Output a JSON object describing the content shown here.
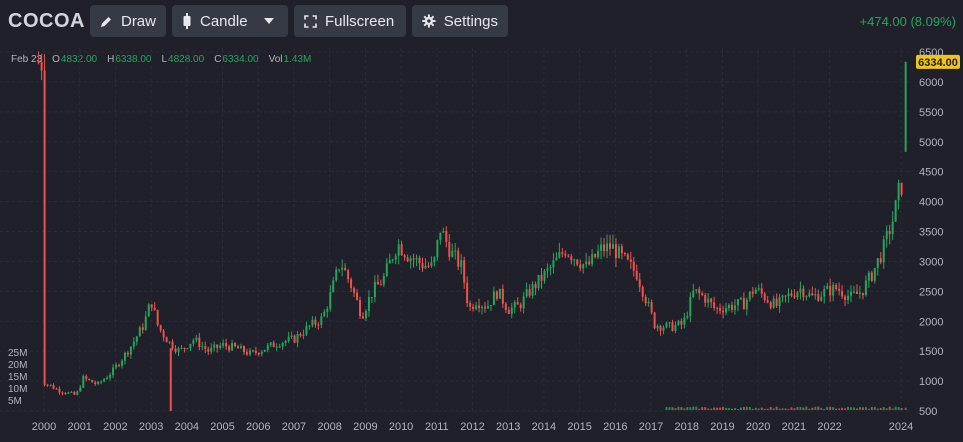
{
  "toolbar": {
    "symbol": "COCOA",
    "draw_label": "Draw",
    "candle_label": "Candle",
    "fullscreen_label": "Fullscreen",
    "settings_label": "Settings",
    "change": "+474.00 (8.09%)"
  },
  "legend": {
    "date": "Feb 23",
    "o_label": "O",
    "o_value": "4832.00",
    "h_label": "H",
    "h_value": "6338.00",
    "l_label": "L",
    "l_value": "4828.00",
    "c_label": "C",
    "c_value": "6334.00",
    "vol_label": "Vol",
    "vol_value": "1.43M"
  },
  "colors": {
    "up": "#26a65b",
    "down": "#ef5350",
    "background": "#1f2029",
    "grid": "#2b2d37",
    "last_price_badge": "#f0c419"
  },
  "chart_data": {
    "type": "candlestick",
    "interval": "monthly",
    "last_price_label": "6334.00",
    "ylim": [
      500,
      6500
    ],
    "y_ticks": [
      6500,
      6000,
      5500,
      5000,
      4500,
      4000,
      3500,
      3000,
      2500,
      2000,
      1500,
      1000,
      500
    ],
    "volume_ticks": [
      "25M",
      "20M",
      "15M",
      "10M",
      "5M"
    ],
    "x_tick_labels": [
      "2000",
      "2001",
      "2002",
      "2003",
      "2004",
      "2005",
      "2006",
      "2007",
      "2008",
      "2009",
      "2010",
      "2011",
      "2012",
      "2013",
      "2014",
      "2015",
      "2016",
      "2017",
      "2018",
      "2019",
      "2020",
      "2021",
      "2022",
      "2024"
    ],
    "price_path": [
      [
        2000.0,
        980
      ],
      [
        2000.4,
        850
      ],
      [
        2000.9,
        760
      ],
      [
        2001.1,
        1050
      ],
      [
        2001.5,
        940
      ],
      [
        2001.9,
        1150
      ],
      [
        2002.4,
        1550
      ],
      [
        2002.8,
        1950
      ],
      [
        2003.0,
        2350
      ],
      [
        2003.2,
        1900
      ],
      [
        2003.5,
        1650
      ],
      [
        2003.8,
        1500
      ],
      [
        2004.2,
        1700
      ],
      [
        2004.6,
        1500
      ],
      [
        2005.0,
        1600
      ],
      [
        2005.4,
        1550
      ],
      [
        2005.8,
        1450
      ],
      [
        2006.2,
        1550
      ],
      [
        2006.6,
        1650
      ],
      [
        2007.0,
        1700
      ],
      [
        2007.4,
        1900
      ],
      [
        2007.8,
        2050
      ],
      [
        2008.0,
        2400
      ],
      [
        2008.3,
        3000
      ],
      [
        2008.6,
        2600
      ],
      [
        2008.9,
        2100
      ],
      [
        2009.2,
        2500
      ],
      [
        2009.5,
        2700
      ],
      [
        2009.9,
        3300
      ],
      [
        2010.2,
        3100
      ],
      [
        2010.6,
        2950
      ],
      [
        2010.9,
        2900
      ],
      [
        2011.1,
        3550
      ],
      [
        2011.4,
        3150
      ],
      [
        2011.7,
        2900
      ],
      [
        2011.9,
        2200
      ],
      [
        2012.1,
        2350
      ],
      [
        2012.4,
        2250
      ],
      [
        2012.7,
        2500
      ],
      [
        2013.0,
        2200
      ],
      [
        2013.3,
        2250
      ],
      [
        2013.6,
        2500
      ],
      [
        2013.9,
        2700
      ],
      [
        2014.2,
        2900
      ],
      [
        2014.6,
        3200
      ],
      [
        2014.9,
        3050
      ],
      [
        2015.2,
        2900
      ],
      [
        2015.6,
        3200
      ],
      [
        2015.9,
        3250
      ],
      [
        2016.2,
        3050
      ],
      [
        2016.6,
        2800
      ],
      [
        2016.9,
        2300
      ],
      [
        2017.1,
        1950
      ],
      [
        2017.5,
        1900
      ],
      [
        2017.9,
        1950
      ],
      [
        2018.2,
        2500
      ],
      [
        2018.5,
        2400
      ],
      [
        2018.8,
        2200
      ],
      [
        2019.2,
        2250
      ],
      [
        2019.6,
        2300
      ],
      [
        2019.9,
        2550
      ],
      [
        2020.2,
        2400
      ],
      [
        2020.5,
        2250
      ],
      [
        2020.9,
        2450
      ],
      [
        2021.2,
        2550
      ],
      [
        2021.5,
        2400
      ],
      [
        2021.9,
        2500
      ],
      [
        2022.2,
        2550
      ],
      [
        2022.6,
        2400
      ],
      [
        2022.9,
        2500
      ],
      [
        2023.2,
        2800
      ],
      [
        2023.5,
        3200
      ],
      [
        2023.8,
        3750
      ],
      [
        2023.95,
        4200
      ],
      [
        2024.05,
        4300
      ],
      [
        2024.13,
        6334
      ]
    ]
  }
}
